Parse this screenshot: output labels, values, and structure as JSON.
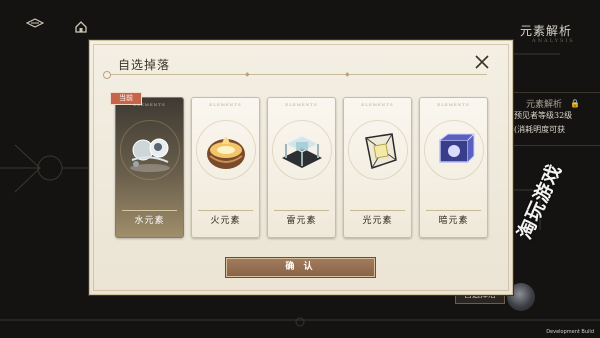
{
  "background": {
    "panel_title": "元素解析",
    "panel_subtitle": "ANALYSIS",
    "info_line1": "元素解析",
    "info_line2": "预见者等级32级",
    "info_line3": "(消耗明度可获",
    "bottom_button": "自选掉落",
    "watermark": "淘玩游戏",
    "build_label": "Development Build"
  },
  "dialog": {
    "title": "自选掉落",
    "cards": [
      {
        "name": "水元素",
        "code": "ELEMENTS",
        "selected": true,
        "tag": "当前"
      },
      {
        "name": "火元素",
        "code": "ELEMENTS"
      },
      {
        "name": "雷元素",
        "code": "ELEMENTS"
      },
      {
        "name": "光元素",
        "code": "ELEMENTS"
      },
      {
        "name": "暗元素",
        "code": "ELEMENTS"
      }
    ],
    "confirm_label": "确 认"
  },
  "colors": {
    "accent": "#c4664b",
    "confirm": "#9a7356",
    "panel": "#f2ede2"
  }
}
